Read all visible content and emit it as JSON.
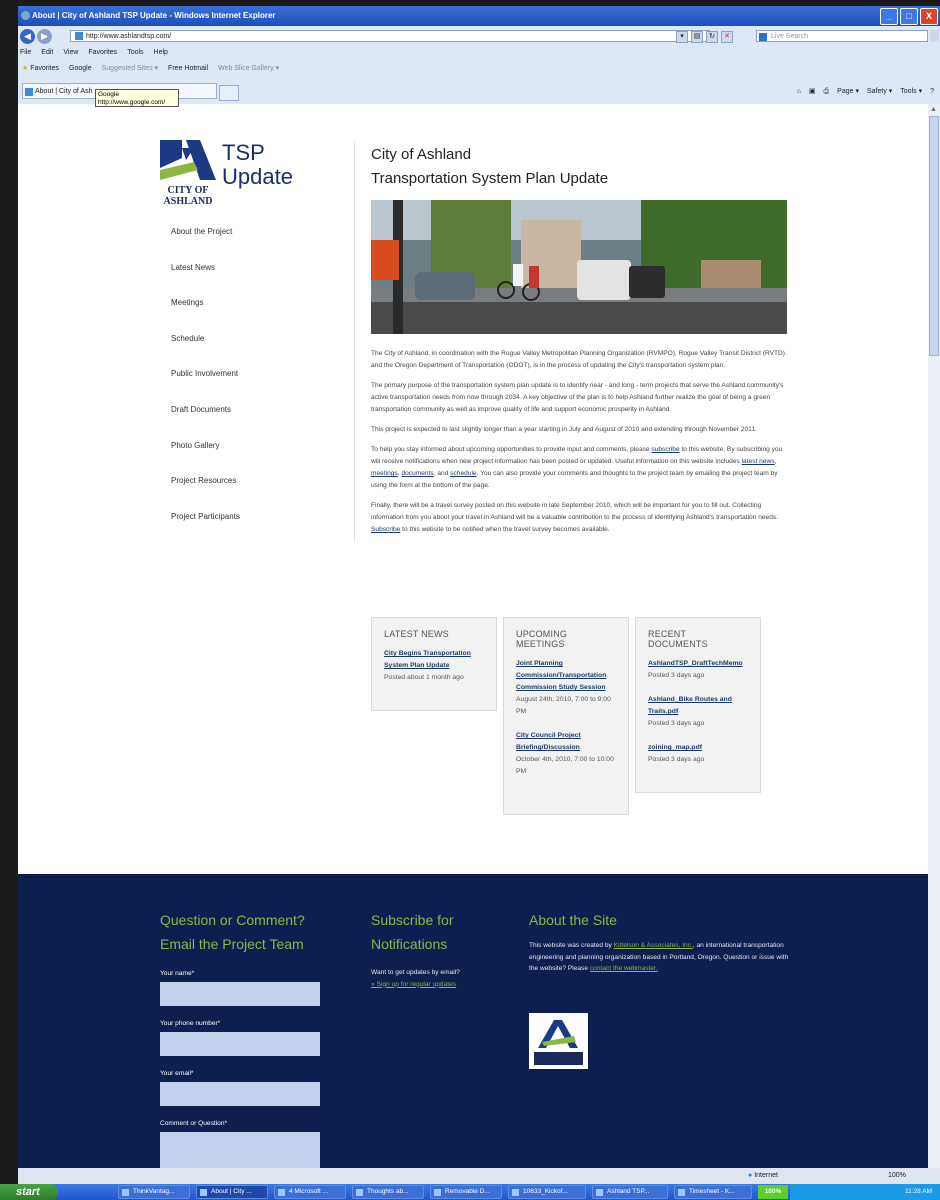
{
  "window": {
    "title": "About | City of Ashland TSP Update - Windows Internet Explorer",
    "controls": [
      "_",
      "□",
      "X"
    ]
  },
  "browser": {
    "url": "http://www.ashlandtsp.com/",
    "search_placeholder": "Live Search",
    "menu": [
      "File",
      "Edit",
      "View",
      "Favorites",
      "Tools",
      "Help"
    ],
    "favorites_bar": {
      "favorites": "Favorites",
      "items": [
        "Google",
        "Suggested Sites ▾",
        "Free Hotmail",
        "Web Slice Gallery ▾"
      ]
    },
    "tab_label": "About | City of Ash",
    "tooltip_title": "Google",
    "tooltip_url": "http://www.google.com/",
    "command_bar": [
      "Page ▾",
      "Safety ▾",
      "Tools ▾"
    ]
  },
  "site": {
    "logo_city_text": "CITY OF ASHLAND",
    "logo_tsp": "TSP",
    "logo_update": "Update",
    "nav": [
      "About the Project",
      "Latest News",
      "Meetings",
      "Schedule",
      "Public Involvement",
      "Draft Documents",
      "Photo Gallery",
      "Project Resources",
      "Project Participants"
    ],
    "heading_line1": "City of Ashland",
    "heading_line2": "Transportation System Plan Update",
    "p1": "The City of Ashland, in coordination with the Rogue Valley Metropolitan Planning Organization (RVMPO), Rogue Valley Transit District (RVTD) and the Oregon Department of Transportation (ODOT), is in the process of updating the City's transportation system plan.",
    "p2": "The primary purpose of the transportation system plan update is to identify near - and long - term projects that serve the Ashland community's active transportation needs from now through 2034. A key objective of the plan is to help Ashland further realize the goal of being a green transportation community as well as improve quality of life and support economic prosperity in Ashland.",
    "p3": "This project is expected to last slightly longer than a year starting in July and August of 2010 and extending through November 2011.",
    "p4": {
      "a": "To help you stay informed about upcoming opportunities to provide input and comments, please ",
      "link_subscribe": "subscribe",
      "b": " to this website. By subscribing you will receive notifications when new project information has been posted or updated. Useful information on this website includes ",
      "link_news": "latest news",
      "c": ", ",
      "link_meetings": "meetings",
      "d": ", ",
      "link_documents": "documents",
      "e": ", and ",
      "link_schedule": "schedule",
      "f": ". You can also provide your comments and thoughts to the project team by emailing the project team by using the form at the bottom of the page."
    },
    "p5": {
      "a": "Finally, there will be a travel survey posted on this website in late September 2010, which will be important for you to fill out. Collecting information from you about your travel in Ashland will be a valuable contribution to the process of identifying Ashland's transportation needs. ",
      "link_subscribe": "Subscribe",
      "b": " to this website to be notified when the travel survey becomes available."
    },
    "latest_news": {
      "heading": "LATEST NEWS",
      "link": "City Begins Transportation System Plan Update",
      "meta": "Posted about 1 month ago"
    },
    "meetings": {
      "heading": "UPCOMING MEETINGS",
      "items": [
        {
          "link": "Joint Planning Commission/Transportation Commission Study Session",
          "meta": "August 24th, 2010, 7:00 to 9:00 PM"
        },
        {
          "link": "City Council Project Briefing/Discussion",
          "meta": "October 4th, 2010, 7:00 to 10:00 PM"
        }
      ]
    },
    "documents": {
      "heading": "RECENT DOCUMENTS",
      "items": [
        {
          "link": "AshlandTSP_DraftTechMemo",
          "meta": "Posted 3 days ago"
        },
        {
          "link": "Ashland_Bike Routes and Trails.pdf",
          "meta": "Posted 3 days ago"
        },
        {
          "link": "zoining_map.pdf",
          "meta": "Posted 3 days ago"
        }
      ]
    },
    "footer": {
      "contact_heading": "Question or Comment? Email the Project Team",
      "labels": [
        "Your name*",
        "Your phone number*",
        "Your email*",
        "Comment or Question*"
      ],
      "subscribe_heading": "Subscribe for Notifications",
      "subscribe_text": "Want to get updates by email?",
      "subscribe_link": "» Sign up for regular updates",
      "about_heading": "About the Site",
      "about_a": "This website was created by ",
      "about_link": "Kittelson & Associates, Inc.",
      "about_b": ", an international transportation engineering and planning organization based in Portland, Oregon. Question or issue with the website? Please ",
      "about_link2": "contact the webmaster."
    }
  },
  "statusbar": {
    "zone": "Internet",
    "zoom": "100%"
  },
  "taskbar": {
    "start": "start",
    "items": [
      "ThinkVantag...",
      "About | City ...",
      "4 Microsoft ...",
      "Thoughts ab...",
      "Removable D...",
      "10633_Kickof...",
      "Ashland TSP...",
      "Timesheet - K..."
    ],
    "zoom": "100%",
    "clock": "11:28 AM"
  },
  "colors": {
    "footer_bg": "#0e1e4f",
    "footer_heading": "#8ab843",
    "brand_blue": "#1a2f6b"
  }
}
